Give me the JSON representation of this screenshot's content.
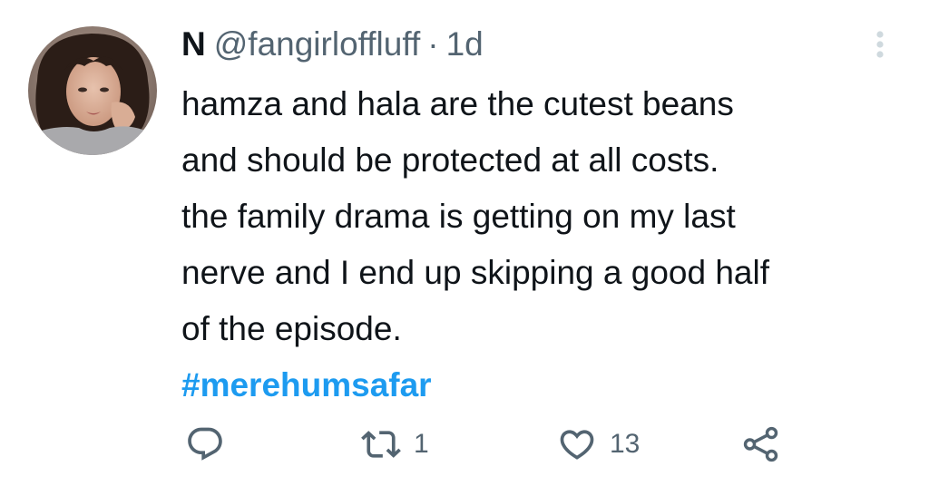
{
  "tweet": {
    "author": {
      "display_name": "N",
      "handle": "@fangirloffluff"
    },
    "separator": "·",
    "time": "1d",
    "body_lines": [
      "hamza and hala are the cutest beans",
      "and should be protected at all costs.",
      "the family drama is getting on my last",
      "nerve and I end up skipping a good half",
      "of the episode."
    ],
    "hashtag": "#merehumsafar",
    "actions": {
      "reply": {
        "icon": "reply-icon",
        "count": ""
      },
      "retweet": {
        "icon": "retweet-icon",
        "count": "1"
      },
      "like": {
        "icon": "heart-icon",
        "count": "13"
      },
      "share": {
        "icon": "share-icon",
        "count": ""
      }
    }
  },
  "colors": {
    "text": "#0f1419",
    "secondary": "#536471",
    "accent": "#1d9bf0",
    "more_dots": "#cfd9de"
  }
}
